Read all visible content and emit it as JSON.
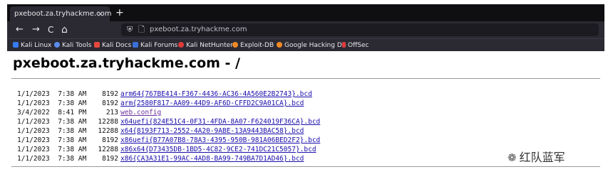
{
  "tab": {
    "title": "pxeboot.za.tryhackme.com",
    "close": "×",
    "new_tab": "+"
  },
  "nav": {
    "back": "←",
    "forward": "→",
    "reload": "C",
    "home": "⌂",
    "url": "pxeboot.za.tryhackme.com"
  },
  "bookmarks": [
    {
      "label": "Kali Linux",
      "color": "#367bf0"
    },
    {
      "label": "Kali Tools",
      "color": "#5b8def"
    },
    {
      "label": "Kali Docs",
      "color": "#e5483b"
    },
    {
      "label": "Kali Forums",
      "color": "#3b6fd8"
    },
    {
      "label": "Kali NetHunter",
      "color": "#e03a3a"
    },
    {
      "label": "Exploit-DB",
      "color": "#f08a24"
    },
    {
      "label": "Google Hacking DB",
      "color": "#f08a24"
    },
    {
      "label": "OffSec",
      "color": "#e03a3a"
    }
  ],
  "page": {
    "heading": "pxeboot.za.tryhackme.com - /",
    "files": [
      {
        "date": "1/1/2023  7:38 AM",
        "size": "8192",
        "name": "arm64{767BE414-F367-4436-AC36-4A560E2B2743}.bcd"
      },
      {
        "date": "1/1/2023  7:38 AM",
        "size": "8192",
        "name": "arm{2580F817-AA09-44D9-AF6D-CFFD2C9A01CA}.bcd"
      },
      {
        "date": "3/4/2022  8:41 PM",
        "size": "213",
        "name": "web.config"
      },
      {
        "date": "1/1/2023  7:38 AM",
        "size": "12288",
        "name": "x64uefi{824E51C4-0F31-4FDA-8A07-F624019F36CA}.bcd"
      },
      {
        "date": "1/1/2023  7:38 AM",
        "size": "12288",
        "name": "x64{8193F713-2552-4A20-9ABE-13A9443BAC58}.bcd"
      },
      {
        "date": "1/1/2023  7:38 AM",
        "size": "8192",
        "name": "x86uefi{B77A07B8-78A3-4395-950B-981A06BED2F2}.bcd"
      },
      {
        "date": "1/1/2023  7:38 AM",
        "size": "12288",
        "name": "x86x64{D73435DB-1BD5-4C82-9CE2-741DC21C5057}.bcd"
      },
      {
        "date": "1/1/2023  7:38 AM",
        "size": "8192",
        "name": "x86{CA3A31E1-99AC-4AD8-BA99-749BA7D1AD46}.bcd"
      }
    ]
  },
  "watermark": {
    "text": "红队蓝军",
    "icon": "wechat-icon"
  }
}
